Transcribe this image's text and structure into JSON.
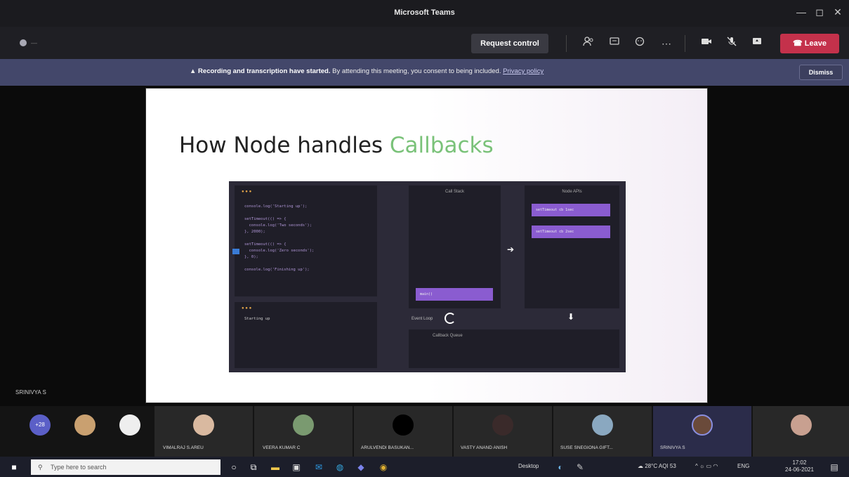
{
  "window": {
    "title": "Microsoft Teams",
    "minimize": "—",
    "maximize": "◻",
    "close": "✕"
  },
  "toolbar": {
    "rec_time": "—",
    "request_control": "Request control",
    "leave": "Leave"
  },
  "banner": {
    "bold": "Recording and transcription have started.",
    "text": "By attending this meeting, you consent to being included.",
    "link": "Privacy policy",
    "dismiss": "Dismiss"
  },
  "slide": {
    "title_main": "How Node handles ",
    "title_accent": "Callbacks",
    "diagram": {
      "call_stack": "Call Stack",
      "node_apis": "Node APIs",
      "event_loop": "Event Loop",
      "callback_queue": "Callback Queue",
      "api_items": [
        "setTimeout cb 1sec",
        "setTimeout cb 2sec"
      ],
      "stack_item": "main()",
      "code": "console.log('Starting up');\n\nsetTimeout(() => {\n  console.log('Two seconds');\n}, 2000);\n\nsetTimeout(() => {\n  console.log('Zero seconds');\n}, 0);\n\nconsole.log('Finishing up');",
      "output": "Starting up"
    }
  },
  "sharer": "SRINIVYA S",
  "participants": [
    {
      "name": "+28"
    },
    {
      "name": ""
    },
    {
      "name": ""
    },
    {
      "name": "VIMALRAJ S.AREU"
    },
    {
      "name": "VEERA KUMAR C"
    },
    {
      "name": "ARULVENDI BASUKAN..."
    },
    {
      "name": "VASTY ANAND ANISH"
    },
    {
      "name": "SUSE SNEGIONA GIFT..."
    },
    {
      "name": "SRINIVYA S"
    },
    {
      "name": ""
    }
  ],
  "taskbar": {
    "search_placeholder": "Type here to search",
    "desktop": "Desktop",
    "weather": "28°C  AQI 53",
    "lang": "ENG",
    "time": "17:02",
    "date": "24-06-2021"
  }
}
